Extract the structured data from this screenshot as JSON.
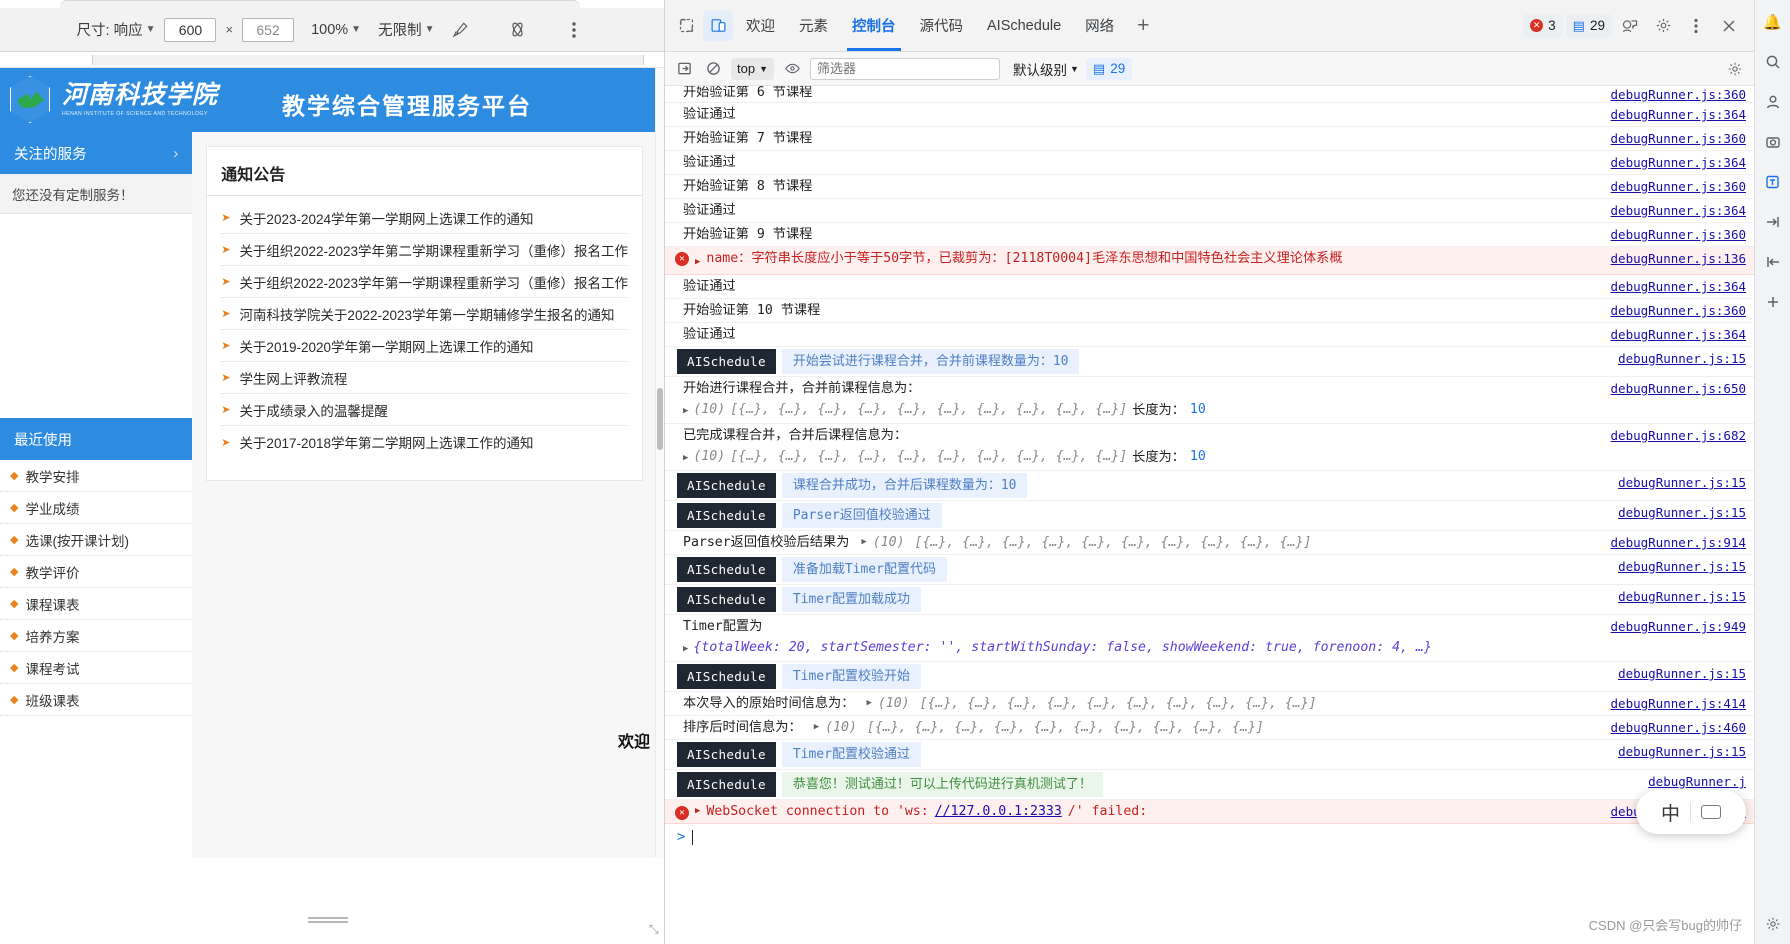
{
  "device_toolbar": {
    "size_label": "尺寸: 响应",
    "width_value": "600",
    "times": "×",
    "height_value": "652",
    "zoom_label": "100%",
    "throttle_label": "无限制",
    "icons": {
      "eyedropper": "eyedropper-icon",
      "media": "media-query-icon",
      "more": "more-vertical-icon"
    }
  },
  "site": {
    "logo_cn": "河南科技学院",
    "logo_en": "HENAN INSTITUTE OF SCIENCE AND TECHNOLOGY",
    "title": "教学综合管理服务平台",
    "left_panel": {
      "focus_header": "关注的服务",
      "chevron": "›",
      "empty_note": "您还没有定制服务！",
      "recent_header": "最近使用",
      "menu": [
        "教学安排",
        "学业成绩",
        "选课(按开课计划)",
        "教学评价",
        "课程课表",
        "培养方案",
        "课程考试",
        "班级课表"
      ]
    },
    "notice_card": {
      "title": "通知公告",
      "items": [
        "关于2023-2024学年第一学期网上选课工作的通知",
        "关于组织2022-2023学年第二学期课程重新学习（重修）报名工作",
        "关于组织2022-2023学年第一学期课程重新学习（重修）报名工作",
        "河南科技学院关于2022-2023学年第一学期辅修学生报名的通知",
        "关于2019-2020学年第一学期网上选课工作的通知",
        "学生网上评教流程",
        "关于成绩录入的温馨提醒",
        "关于2017-2018学年第二学期网上选课工作的通知"
      ]
    },
    "welcome": "欢迎"
  },
  "devtools": {
    "tabs": [
      {
        "label": "欢迎",
        "selected": false
      },
      {
        "label": "元素",
        "selected": false
      },
      {
        "label": "控制台",
        "selected": true
      },
      {
        "label": "源代码",
        "selected": false
      },
      {
        "label": "AISchedule",
        "selected": false
      },
      {
        "label": "网络",
        "selected": false
      }
    ],
    "plus": "+",
    "error_count": "3",
    "message_count": "29",
    "icons": {
      "inspect": "inspect-element-icon",
      "device": "device-toolbar-icon",
      "remote": "remote-devices-icon",
      "settings": "settings-gear-icon",
      "more": "more-vertical-icon",
      "close": "close-icon"
    },
    "filter_bar": {
      "sidebar_toggle": "console-sidebar-icon",
      "clear": "clear-console-icon",
      "context": "top",
      "eye": "live-expression-icon",
      "filter_placeholder": "筛选器",
      "filter_value": "",
      "level": "默认级别",
      "count": "29",
      "settings": "console-settings-icon"
    },
    "prompt": ">"
  },
  "console_rows": [
    {
      "type": "log",
      "text": "开始验证第 6 节课程",
      "source": "debugRunner.js:360",
      "clipped_top": true
    },
    {
      "type": "log",
      "text": "验证通过",
      "source": "debugRunner.js:364"
    },
    {
      "type": "log",
      "text": "开始验证第 7 节课程",
      "source": "debugRunner.js:360"
    },
    {
      "type": "log",
      "text": "验证通过",
      "source": "debugRunner.js:364"
    },
    {
      "type": "log",
      "text": "开始验证第 8 节课程",
      "source": "debugRunner.js:360"
    },
    {
      "type": "log",
      "text": "验证通过",
      "source": "debugRunner.js:364"
    },
    {
      "type": "log",
      "text": "开始验证第 9 节课程",
      "source": "debugRunner.js:360"
    },
    {
      "type": "error",
      "text": "name：字符串长度应小于等于50字节，已裁剪为：[2118T0004]毛泽东思想和中国特色社会主义理论体系概",
      "source": "debugRunner.js:136"
    },
    {
      "type": "log",
      "text": "验证通过",
      "source": "debugRunner.js:364"
    },
    {
      "type": "log",
      "text": "开始验证第 10 节课程",
      "source": "debugRunner.js:360"
    },
    {
      "type": "log",
      "text": "验证通过",
      "source": "debugRunner.js:364"
    },
    {
      "type": "tag",
      "tag": "AISchedule",
      "text": "开始尝试进行课程合并，合并前课程数量为：10",
      "source": "debugRunner.js:15"
    },
    {
      "type": "array",
      "text": "开始进行课程合并，合并前课程信息为：",
      "count": "(10)",
      "array": "[{…}, {…}, {…}, {…}, {…}, {…}, {…}, {…}, {…}, {…}]",
      "suffix": "长度为：",
      "suffix_num": "10",
      "source": "debugRunner.js:650"
    },
    {
      "type": "array",
      "text": "已完成课程合并，合并后课程信息为：",
      "count": "(10)",
      "array": "[{…}, {…}, {…}, {…}, {…}, {…}, {…}, {…}, {…}, {…}]",
      "suffix": "长度为：",
      "suffix_num": "10",
      "source": "debugRunner.js:682"
    },
    {
      "type": "tag",
      "tag": "AISchedule",
      "text": "课程合并成功，合并后课程数量为：10",
      "source": "debugRunner.js:15"
    },
    {
      "type": "tag",
      "tag": "AISchedule",
      "text": "Parser返回值校验通过",
      "source": "debugRunner.js:15"
    },
    {
      "type": "inline-array",
      "text": "Parser返回值校验后结果为",
      "count": "(10)",
      "array": "[{…}, {…}, {…}, {…}, {…}, {…}, {…}, {…}, {…}, {…}]",
      "source": "debugRunner.js:914"
    },
    {
      "type": "tag",
      "tag": "AISchedule",
      "text": "准备加载Timer配置代码",
      "source": "debugRunner.js:15"
    },
    {
      "type": "tag",
      "tag": "AISchedule",
      "text": "Timer配置加载成功",
      "source": "debugRunner.js:15"
    },
    {
      "type": "object",
      "text": "Timer配置为",
      "object": "{totalWeek: 20, startSemester: '', startWithSunday: false, showWeekend: true, forenoon: 4, …}",
      "source": "debugRunner.js:949"
    },
    {
      "type": "tag",
      "tag": "AISchedule",
      "text": "Timer配置校验开始",
      "source": "debugRunner.js:15"
    },
    {
      "type": "inline-array",
      "text": "本次导入的原始时间信息为：",
      "count": "(10)",
      "array": "[{…}, {…}, {…}, {…}, {…}, {…}, {…}, {…}, {…}, {…}]",
      "source": "debugRunner.js:414"
    },
    {
      "type": "inline-array",
      "text": "排序后时间信息为：",
      "count": "(10)",
      "array": "[{…}, {…}, {…}, {…}, {…}, {…}, {…}, {…}, {…}, {…}]",
      "source": "debugRunner.js:460"
    },
    {
      "type": "tag",
      "tag": "AISchedule",
      "text": "Timer配置校验通过",
      "source": "debugRunner.js:15"
    },
    {
      "type": "tag-ok",
      "tag": "AISchedule",
      "text": "恭喜您！测试通过！可以上传代码进行真机测试了！",
      "source": "debugRunner.j"
    },
    {
      "type": "error-ws",
      "prefix": "WebSocket connection to 'ws:",
      "link": "//127.0.0.1:2333",
      "suffix": "/' failed:",
      "source": "debugRunner.js:743"
    }
  ],
  "ime": {
    "label": "中"
  },
  "watermark": "CSDN @只会写bug的帅仔"
}
